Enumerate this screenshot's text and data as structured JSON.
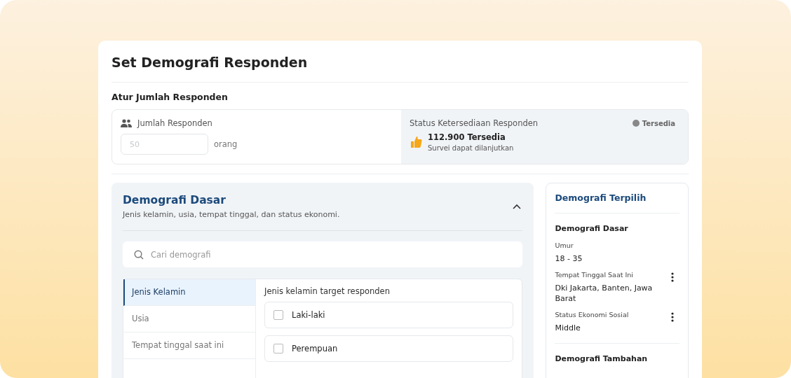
{
  "title": "Set Demografi Responden",
  "quota": {
    "heading": "Atur Jumlah Responden",
    "label": "Jumlah Responden",
    "placeholder": "50",
    "unit": "orang"
  },
  "availability": {
    "title": "Status Ketersediaan Responden",
    "badge": "Tersedia",
    "count": "112.900 Tersedia",
    "note": "Survei dapat dilanjutkan"
  },
  "section": {
    "title": "Demografi Dasar",
    "subtitle": "Jenis kelamin, usia, tempat tinggal, dan status ekonomi.",
    "expanded": true,
    "search_placeholder": "Cari demografi",
    "categories": [
      {
        "label": "Jenis Kelamin",
        "selected": true
      },
      {
        "label": "Usia",
        "selected": false
      },
      {
        "label": "Tempat tinggal saat ini",
        "selected": false
      }
    ],
    "options_title": "Jenis kelamin target responden",
    "options": [
      {
        "label": "Laki-laki",
        "checked": false
      },
      {
        "label": "Perempuan",
        "checked": false
      }
    ]
  },
  "selected_panel": {
    "title": "Demografi Terpilih",
    "group": "Demografi Dasar",
    "items": [
      {
        "label": "Umur",
        "value": "18 - 35",
        "menu": false
      },
      {
        "label": "Tempat Tinggal Saat Ini",
        "value": "Dki Jakarta, Banten, Jawa Barat",
        "menu": true
      },
      {
        "label": "Status Ekonomi Sosial",
        "value": "Middle",
        "menu": true
      }
    ],
    "next_group": "Demografi Tambahan"
  }
}
